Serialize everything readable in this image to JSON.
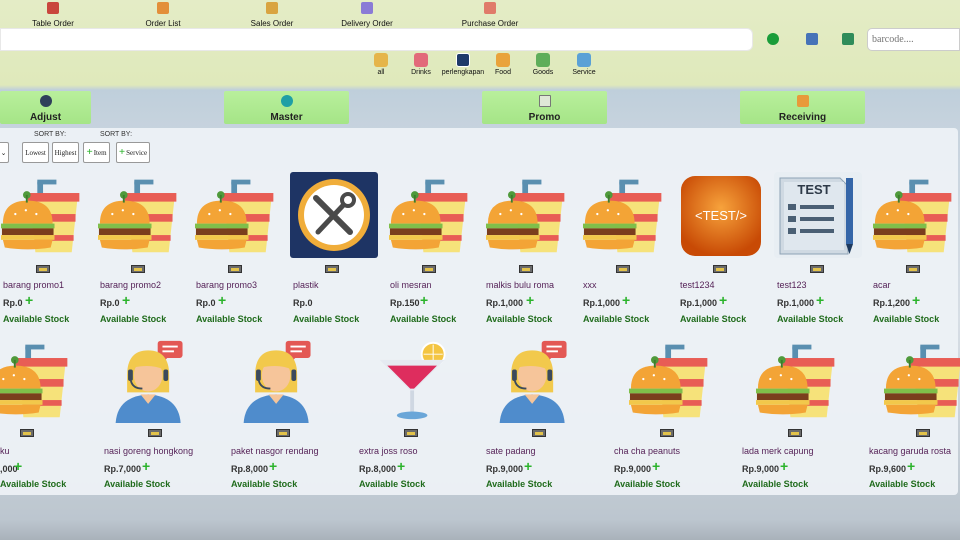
{
  "topnav": [
    {
      "label": "Table Order",
      "icon": "table-order-icon",
      "color": "#c9463d"
    },
    {
      "label": "Order List",
      "icon": "order-list-icon",
      "color": "#e38f3a"
    },
    {
      "label": "Sales Order",
      "icon": "sales-order-icon",
      "color": "#d9a441"
    },
    {
      "label": "Delivery Order",
      "icon": "delivery-order-icon",
      "color": "#8a7bd6"
    },
    {
      "label": "Purchase Order",
      "icon": "purchase-order-icon",
      "color": "#e07b6a"
    }
  ],
  "barcode": {
    "placeholder": "barcode...."
  },
  "categories": [
    {
      "label": "all",
      "icon": "all-categories-icon"
    },
    {
      "label": "Drinks",
      "icon": "drinks-icon"
    },
    {
      "label": "perlengkapan",
      "icon": "tools-icon"
    },
    {
      "label": "Food",
      "icon": "food-icon"
    },
    {
      "label": "Goods",
      "icon": "goods-icon"
    },
    {
      "label": "Service",
      "icon": "service-icon"
    }
  ],
  "actions": [
    {
      "label": "Adjust",
      "icon": "adjust-icon"
    },
    {
      "label": "Master",
      "icon": "master-icon"
    },
    {
      "label": "Promo",
      "icon": "promo-icon"
    },
    {
      "label": "Receiving",
      "icon": "receiving-icon"
    }
  ],
  "sort": {
    "label1": "SORT BY:",
    "label2": "SORT BY:",
    "lowest": "Lowest",
    "highest": "Highest",
    "item": "Item",
    "service": "Service"
  },
  "stock_label": "Available Stock",
  "row1": [
    {
      "name": "barang promo1",
      "price": "Rp.0",
      "img": "burger-combo"
    },
    {
      "name": "barang promo2",
      "price": "Rp.0",
      "img": "burger-combo"
    },
    {
      "name": "barang promo3",
      "price": "Rp.0",
      "img": "burger-combo"
    },
    {
      "name": "plastik",
      "price": "Rp.0",
      "img": "tools"
    },
    {
      "name": "oli mesran",
      "price": "Rp.150",
      "img": "burger-combo"
    },
    {
      "name": "malkis bulu roma",
      "price": "Rp.1,000",
      "img": "burger-combo"
    },
    {
      "name": "xxx",
      "price": "Rp.1,000",
      "img": "burger-combo"
    },
    {
      "name": "test1234",
      "price": "Rp.1,000",
      "img": "test-tag"
    },
    {
      "name": "test123",
      "price": "Rp.1,000",
      "img": "test-doc"
    },
    {
      "name": "acar",
      "price": "Rp.1,200",
      "img": "burger-combo"
    }
  ],
  "row2": [
    {
      "name": "ku",
      "price": ",000",
      "img": "burger-combo"
    },
    {
      "name": "nasi goreng hongkong",
      "price": "Rp.7,000",
      "img": "support-agent"
    },
    {
      "name": "paket nasgor rendang",
      "price": "Rp.8,000",
      "img": "support-agent"
    },
    {
      "name": "extra joss roso",
      "price": "Rp.8,000",
      "img": "cocktail"
    },
    {
      "name": "sate padang",
      "price": "Rp.9,000",
      "img": "support-agent"
    },
    {
      "name": "cha cha peanuts",
      "price": "Rp.9,000",
      "img": "burger-combo"
    },
    {
      "name": "lada merk capung",
      "price": "Rp.9,000",
      "img": "burger-combo"
    },
    {
      "name": "kacang garuda rosta",
      "price": "Rp.9,600",
      "img": "burger-combo"
    }
  ]
}
